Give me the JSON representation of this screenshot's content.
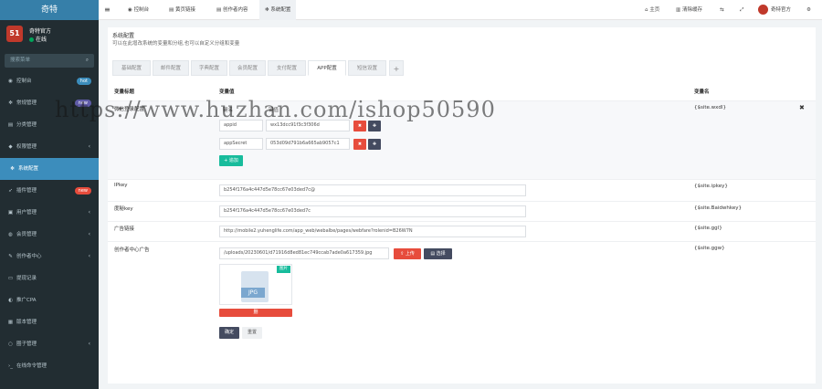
{
  "brand": "奇特",
  "user": {
    "avatar_text": "51",
    "name": "奇特官方",
    "status": "在线"
  },
  "search": {
    "placeholder": "搜索菜单"
  },
  "menu": [
    {
      "label": "控制台",
      "icon": "dashboard-icon",
      "badge": "hot",
      "badge_color": "#3c8dbc"
    },
    {
      "label": "常规管理",
      "icon": "cogs-icon",
      "badge": "new",
      "badge_color": "#605ca8"
    },
    {
      "label": "分类管理",
      "icon": "list-icon"
    },
    {
      "label": "权限管理",
      "icon": "group-icon",
      "arrow": "‹"
    },
    {
      "label": "系统配置",
      "icon": "gear-icon",
      "active": true
    },
    {
      "label": "插件管理",
      "icon": "rocket-icon",
      "badge": "new",
      "badge_color": "#e74c3c"
    },
    {
      "label": "用户管理",
      "icon": "user-icon",
      "arrow": "‹"
    },
    {
      "label": "会员管理",
      "icon": "users-icon",
      "arrow": "‹"
    },
    {
      "label": "创作者中心",
      "icon": "pen-icon",
      "arrow": "‹"
    },
    {
      "label": "提现记录",
      "icon": "money-icon"
    },
    {
      "label": "推广CPA",
      "icon": "share-icon"
    },
    {
      "label": "版本管理",
      "icon": "version-icon"
    },
    {
      "label": "圈子管理",
      "icon": "circle-icon",
      "arrow": "‹"
    },
    {
      "label": "在线命令管理",
      "icon": "terminal-icon"
    }
  ],
  "topbar": {
    "tabs": [
      "控制台",
      "黄页链接",
      "创作者内容",
      "系统配置"
    ],
    "right": [
      "主页",
      "清除缓存",
      "奇特官方"
    ]
  },
  "page": {
    "title": "系统配置",
    "subtitle": "可以在此增改系统的变量和分组,也可以自定义分组和变量",
    "subtabs": [
      "基础配置",
      "邮件配置",
      "字典配置",
      "会员配置",
      "支付配置",
      "APP配置",
      "短信设置",
      "+"
    ],
    "headers": {
      "title": "变量标题",
      "value": "变量值",
      "name": "变量名"
    },
    "rows": {
      "wxdl": {
        "title": "微信登录配置",
        "col_key": "键名",
        "col_val": "键值",
        "items": [
          {
            "key": "appid",
            "value": "wx13dcc91f3c3f306d"
          },
          {
            "key": "appSecret",
            "value": "053d09d791b6a665ab9057c1"
          }
        ],
        "add_label": "+ 追加",
        "name": "{$site.wxdl}"
      },
      "ipkey": {
        "title": "IPkey",
        "value": "b254f176a4c447d5e78cc67e03ded7c@",
        "name": "{$site.ipkey}"
      },
      "baidu": {
        "title": "度秘key",
        "value": "b254f176a4c447d5e78cc67e03ded7c",
        "name": "{$site.Baidwhkey}"
      },
      "ggl": {
        "title": "广告链接",
        "value": "http://mobile2.yuhenglife.com/app_web/webalbe/pages/webfare?rolenid=B26W7N",
        "name": "{$site.ggl}"
      },
      "ggw": {
        "title": "创作者中心广告",
        "value": "/uploads/20230601/d71916d8ed81ec749ccab7ade0a617359.jpg",
        "upload_label": "上传",
        "select_label": "选择",
        "preview_badge": "图片",
        "preview_ext": "JPG",
        "delete_label": "删",
        "name": "{$site.ggw}"
      }
    },
    "buttons": {
      "confirm": "确定",
      "reset": "重置"
    }
  },
  "watermark": "https://www.huzhan.com/ishop50590"
}
